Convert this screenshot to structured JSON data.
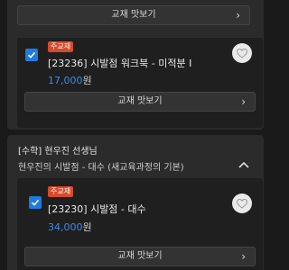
{
  "top_section": {
    "preview_label": "교재 맛보기",
    "item": {
      "badge": "주교재",
      "title": "[23236] 시발점 워크북 - 미적분 I",
      "price": "17,000",
      "currency": "원",
      "preview_label": "교재 맛보기"
    }
  },
  "bottom_section": {
    "subject": "[수학] 현우진 선생님",
    "course": "현우진의 시발점 - 대수 (새교육과정의 기본)",
    "item": {
      "badge": "주교재",
      "title": "[23230] 시발점 - 대수",
      "price": "34,000",
      "currency": "원",
      "preview_label": "교재 맛보기"
    }
  },
  "icons": {
    "check": "check-icon",
    "heart": "heart-icon",
    "chevron_right": "chevron-right-icon",
    "chevron_up": "chevron-up-icon"
  },
  "colors": {
    "accent_blue": "#1f7be0",
    "price_blue": "#3d8ae8",
    "badge_red": "#d64a2c"
  }
}
